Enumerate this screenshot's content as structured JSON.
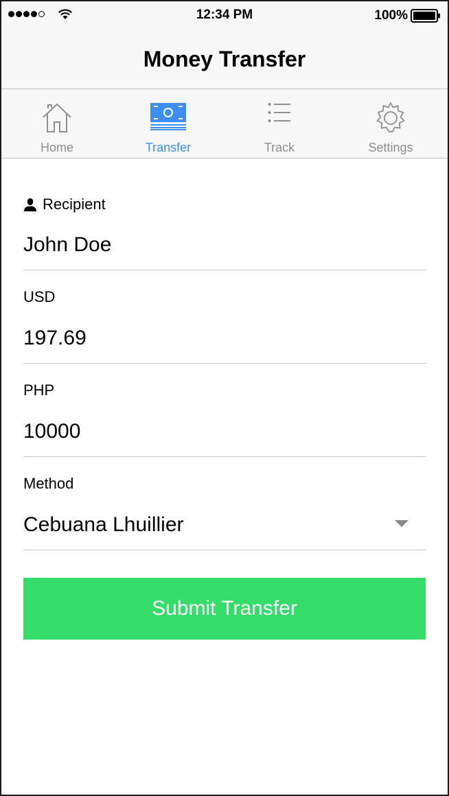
{
  "status_bar": {
    "time": "12:34 PM",
    "battery": "100%"
  },
  "nav": {
    "title": "Money Transfer"
  },
  "tabs": [
    {
      "label": "Home",
      "icon": "home-icon",
      "active": false
    },
    {
      "label": "Transfer",
      "icon": "money-icon",
      "active": true
    },
    {
      "label": "Track",
      "icon": "list-icon",
      "active": false
    },
    {
      "label": "Settings",
      "icon": "gear-icon",
      "active": false
    }
  ],
  "form": {
    "recipient": {
      "label": "Recipient",
      "value": "John Doe"
    },
    "usd": {
      "label": "USD",
      "value": "197.69"
    },
    "php": {
      "label": "PHP",
      "value": "10000"
    },
    "method": {
      "label": "Method",
      "value": "Cebuana Lhuillier"
    }
  },
  "submit_label": "Submit Transfer",
  "colors": {
    "accent": "#3d8ef0",
    "submit": "#34dc69",
    "tab_inactive": "#8e8e8e"
  }
}
